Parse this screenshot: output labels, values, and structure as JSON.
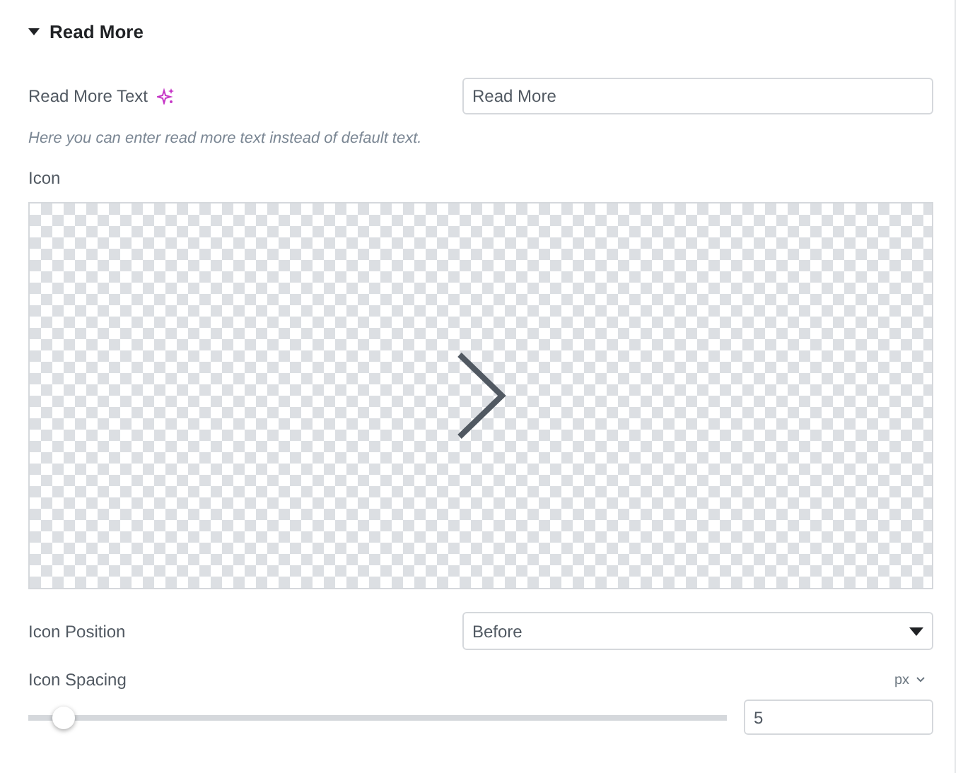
{
  "section": {
    "title": "Read More",
    "expanded": true
  },
  "read_more_text": {
    "label": "Read More Text",
    "value": "Read More",
    "help": "Here you can enter read more text instead of default text."
  },
  "icon": {
    "label": "Icon"
  },
  "icon_position": {
    "label": "Icon Position",
    "value": "Before"
  },
  "icon_spacing": {
    "label": "Icon Spacing",
    "unit": "px",
    "level": 0.05,
    "value": "5"
  }
}
